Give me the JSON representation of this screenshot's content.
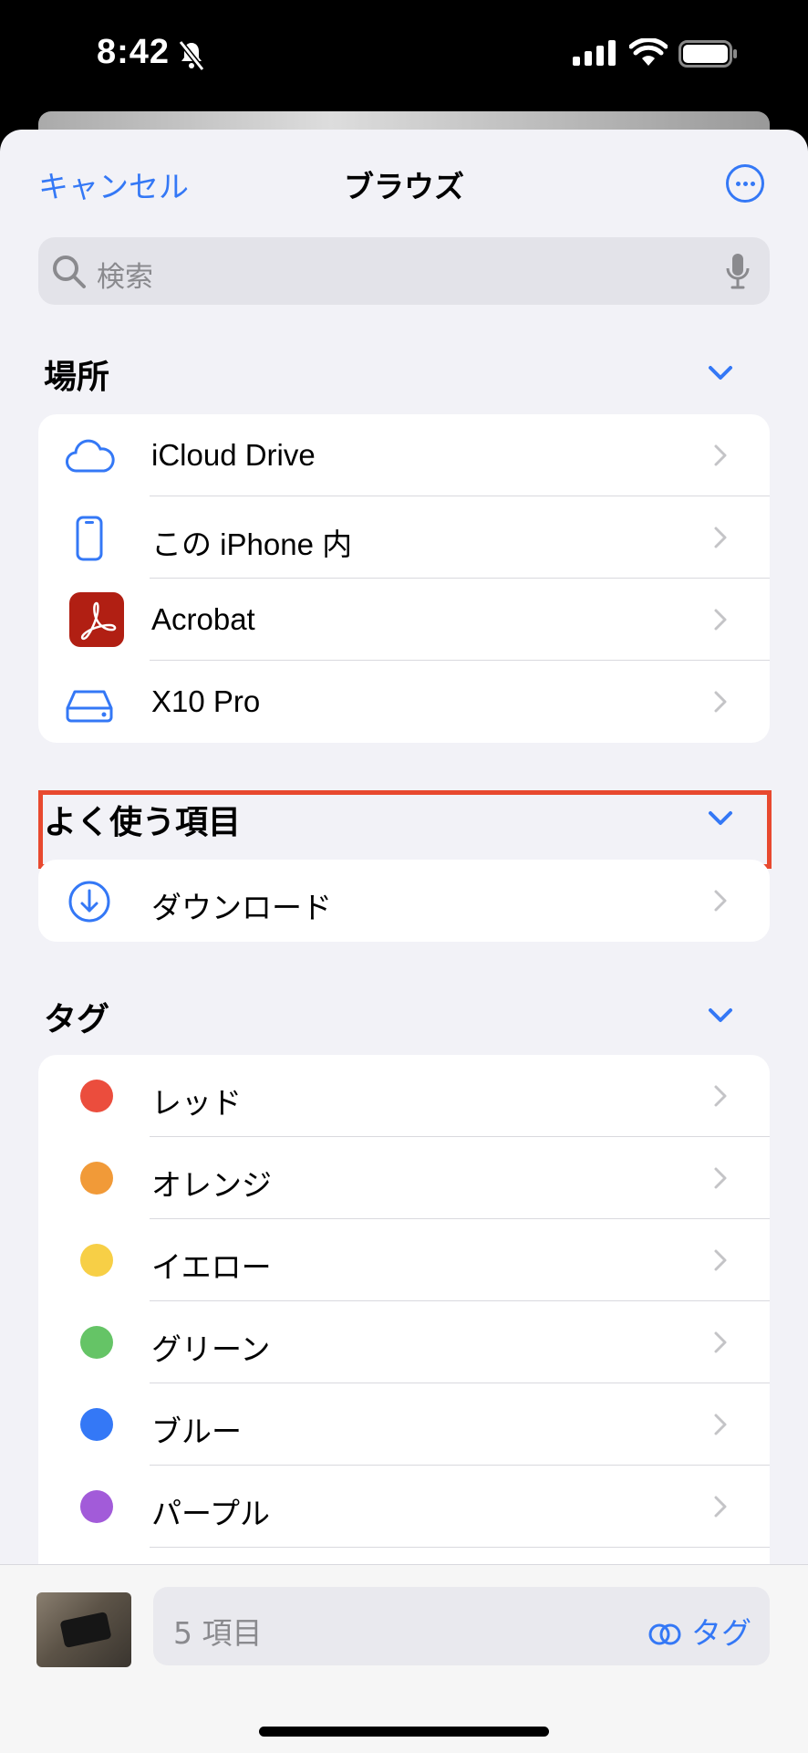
{
  "status": {
    "time": "8:42"
  },
  "header": {
    "cancel": "キャンセル",
    "title": "ブラウズ"
  },
  "search": {
    "placeholder": "検索"
  },
  "sections": {
    "locations": {
      "title": "場所",
      "items": [
        {
          "label": "iCloud Drive",
          "icon": "icloud-icon"
        },
        {
          "label": "この iPhone 内",
          "icon": "iphone-icon"
        },
        {
          "label": "Acrobat",
          "icon": "acrobat-icon"
        },
        {
          "label": "X10 Pro",
          "icon": "external-drive-icon"
        }
      ]
    },
    "favorites": {
      "title": "よく使う項目",
      "items": [
        {
          "label": "ダウンロード",
          "icon": "download-icon"
        }
      ]
    },
    "tags": {
      "title": "タグ",
      "items": [
        {
          "label": "レッド",
          "color": "#eb4d3d"
        },
        {
          "label": "オレンジ",
          "color": "#f19a38"
        },
        {
          "label": "イエロー",
          "color": "#f7cf46"
        },
        {
          "label": "グリーン",
          "color": "#65c466"
        },
        {
          "label": "ブルー",
          "color": "#3478f6"
        },
        {
          "label": "パープル",
          "color": "#a25bd9"
        }
      ]
    }
  },
  "bottom": {
    "count": "5 項目",
    "tag": "タグ"
  },
  "colors": {
    "accent": "#3478f6",
    "highlight": "#e8492f",
    "acrobat": "#b11f13"
  }
}
